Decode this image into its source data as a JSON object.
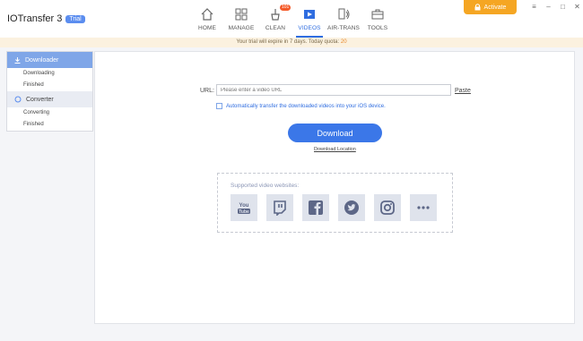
{
  "app": {
    "title": "IOTransfer 3",
    "badge": "Trial"
  },
  "nav": [
    {
      "label": "HOME",
      "icon": "home-icon"
    },
    {
      "label": "MANAGE",
      "icon": "manage-icon"
    },
    {
      "label": "CLEAN",
      "icon": "clean-icon",
      "badge": "101"
    },
    {
      "label": "VIDEOS",
      "icon": "videos-icon",
      "active": true
    },
    {
      "label": "AIR-TRANS",
      "icon": "air-trans-icon"
    },
    {
      "label": "TOOLS",
      "icon": "tools-icon"
    }
  ],
  "activate_label": "Activate",
  "banner": {
    "text": "Your trial will expire in 7 days. Today quota: ",
    "quota": "20"
  },
  "sidebar": {
    "downloader": "Downloader",
    "downloading": "Downloading",
    "finished1": "Finished",
    "converter": "Converter",
    "converting": "Converting",
    "finished2": "Finished"
  },
  "main": {
    "url_label": "URL:",
    "url_placeholder": "Please enter a video URL",
    "paste": "Paste",
    "auto_text": "Automatically transfer the downloaded videos into your iOS device.",
    "download": "Download",
    "download_location": "Download Location",
    "supported_title": "Supported video websites:"
  },
  "sites": [
    "youtube-icon",
    "twitch-icon",
    "facebook-icon",
    "twitter-icon",
    "instagram-icon",
    "more-icon"
  ],
  "colors": {
    "accent": "#3b77e8",
    "activate": "#f5a623",
    "sidebar_active": "#7fa6e8"
  }
}
